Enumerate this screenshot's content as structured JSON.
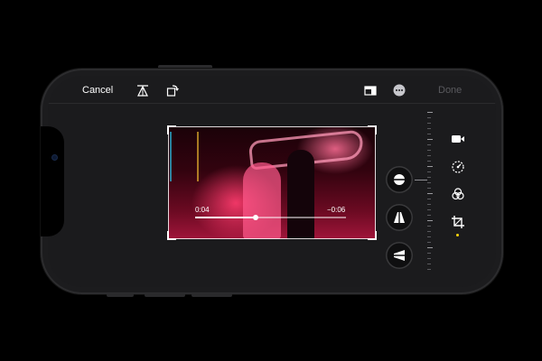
{
  "toolbar": {
    "cancel_label": "Cancel",
    "done_label": "Done"
  },
  "icons": {
    "top": [
      "perspective-icon",
      "rotate-icon",
      "aspect-ratio-icon",
      "more-icon"
    ],
    "side": [
      "video-icon",
      "adjust-icon",
      "filters-icon",
      "crop-icon"
    ],
    "straighten": [
      "straighten-icon",
      "vertical-perspective-icon",
      "horizontal-perspective-icon"
    ]
  },
  "player": {
    "elapsed": "0:04",
    "remaining": "−0:06",
    "progress": 0.4
  },
  "colors": {
    "accent_active": "#ffd60a",
    "done_disabled": "#5a5a5e"
  }
}
